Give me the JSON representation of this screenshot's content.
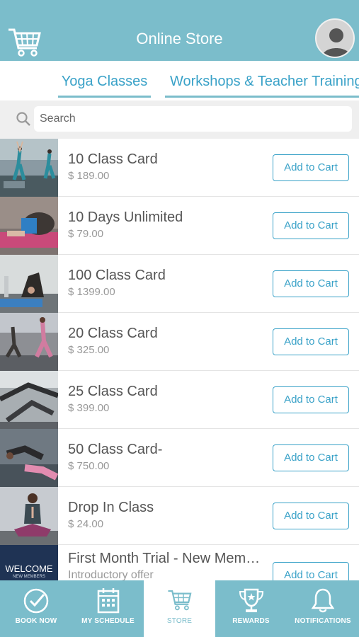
{
  "header": {
    "title": "Online Store",
    "cart_icon": "cart-icon",
    "avatar_icon": "user-avatar-icon",
    "color": "#7bbdcb"
  },
  "tabs": [
    {
      "label": "Yoga Classes"
    },
    {
      "label": "Workshops & Teacher Training"
    }
  ],
  "search": {
    "placeholder": "Search",
    "value": ""
  },
  "items": [
    {
      "name": "10 Class Card",
      "price": "$ 189.00",
      "button": "Add to Cart"
    },
    {
      "name": "10 Days Unlimited",
      "price": "$ 79.00",
      "button": "Add to Cart"
    },
    {
      "name": "100 Class Card",
      "price": "$ 1399.00",
      "button": "Add to Cart"
    },
    {
      "name": "20 Class Card",
      "price": "$ 325.00",
      "button": "Add to Cart"
    },
    {
      "name": "25 Class Card",
      "price": "$ 399.00",
      "button": "Add to Cart"
    },
    {
      "name": "50 Class Card-",
      "price": "$ 750.00",
      "button": "Add to Cart"
    },
    {
      "name": "Drop In Class",
      "price": "$ 24.00",
      "button": "Add to Cart"
    },
    {
      "name": "First Month Trial - New Members",
      "price": "Introductory offer",
      "button": "Add to Cart",
      "thumb_text": "WELCOME",
      "thumb_subtext": "NEW MEMBERS"
    }
  ],
  "nav": [
    {
      "label": "BOOK NOW",
      "icon": "check-circle-icon"
    },
    {
      "label": "MY SCHEDULE",
      "icon": "calendar-icon"
    },
    {
      "label": "STORE",
      "icon": "cart-icon",
      "active": true
    },
    {
      "label": "REWARDS",
      "icon": "trophy-icon"
    },
    {
      "label": "NOTIFICATIONS",
      "icon": "bell-icon"
    }
  ],
  "accent_color": "#3aa2c8"
}
